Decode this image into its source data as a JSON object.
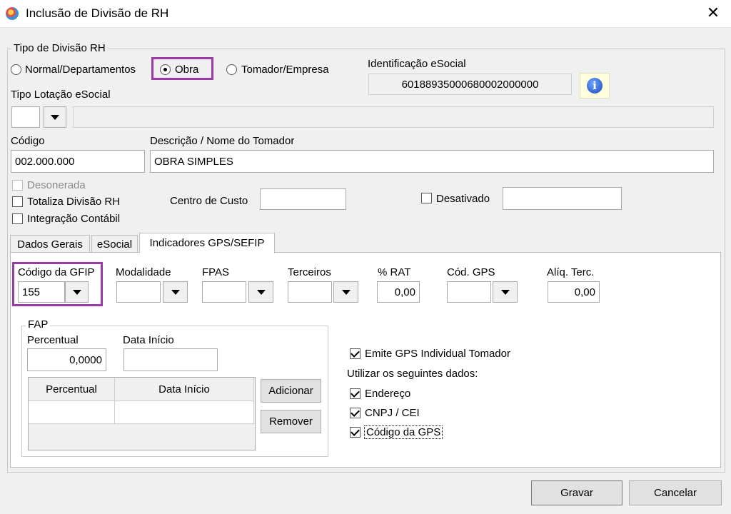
{
  "window": {
    "title": "Inclusão de Divisão de RH",
    "close_icon": "close-icon"
  },
  "tipo_divisao": {
    "legend": "Tipo de Divisão RH",
    "options": [
      "Normal/Departamentos",
      "Obra",
      "Tomador/Empresa"
    ],
    "selected": "Obra"
  },
  "identificacao": {
    "label": "Identificação eSocial",
    "value": "60188935000680002000000"
  },
  "tipo_lotacao": {
    "label": "Tipo Lotação eSocial",
    "code": "",
    "description": ""
  },
  "codigo": {
    "label": "Código",
    "value": "002.000.000"
  },
  "descricao": {
    "label": "Descrição / Nome do Tomador",
    "value": "OBRA SIMPLES"
  },
  "checks": {
    "desonerada": {
      "label": "Desonerada",
      "checked": false,
      "enabled": false
    },
    "totaliza": {
      "label": "Totaliza Divisão RH",
      "checked": false
    },
    "integracao": {
      "label": "Integração Contábil",
      "checked": false
    },
    "desativado": {
      "label": "Desativado",
      "checked": false,
      "value": ""
    }
  },
  "centro_custo": {
    "label": "Centro de Custo",
    "value": ""
  },
  "tabs": [
    {
      "label": "Dados Gerais"
    },
    {
      "label": "eSocial"
    },
    {
      "label": "Indicadores GPS/SEFIP",
      "active": true
    }
  ],
  "gps": {
    "codigo_gfip": {
      "label": "Código da GFIP",
      "value": "155"
    },
    "modalidade": {
      "label": "Modalidade",
      "value": ""
    },
    "fpas": {
      "label": "FPAS",
      "value": ""
    },
    "terceiros": {
      "label": "Terceiros",
      "value": ""
    },
    "rat": {
      "label": "% RAT",
      "value": "0,00"
    },
    "cod_gps": {
      "label": "Cód. GPS",
      "value": ""
    },
    "aliq_terc": {
      "label": "Alíq. Terc.",
      "value": "0,00"
    }
  },
  "fap": {
    "legend": "FAP",
    "percentual_label": "Percentual",
    "percentual_value": "0,0000",
    "data_inicio_label": "Data Início",
    "data_inicio_value": "",
    "grid_headers": [
      "Percentual",
      "Data Início"
    ],
    "add_button": "Adicionar",
    "remove_button": "Remover"
  },
  "emite": {
    "label": "Emite GPS Individual Tomador",
    "checked": true,
    "utilizar_label": "Utilizar os seguintes dados:",
    "endereco": "Endereço",
    "cnpj": "CNPJ / CEI",
    "codigo_gps": "Código da GPS"
  },
  "footer": {
    "gravar": "Gravar",
    "cancelar": "Cancelar"
  },
  "colors": {
    "highlight": "#9b3aa6",
    "info_bg": "#ffffe0"
  }
}
